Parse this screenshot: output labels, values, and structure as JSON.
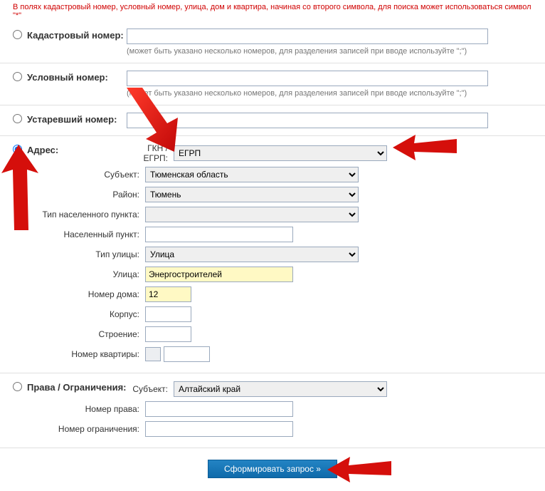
{
  "note": "В полях кадастровый номер, условный номер, улица, дом и квартира, начиная со второго символа, для поиска может использоваться символ \"*\"",
  "hint_multi": "(может быть указано несколько номеров, для разделения записей при вводе используйте \";\")",
  "sections": {
    "cad": {
      "label": "Кадастровый номер:"
    },
    "cond": {
      "label": "Условный номер:"
    },
    "old": {
      "label": "Устаревший номер:"
    },
    "addr": {
      "label": "Адрес:"
    },
    "rights": {
      "label": "Права / Ограничения:"
    }
  },
  "addr_fields": {
    "gkn": {
      "label": "ГКН / ЕГРП:",
      "value": "ЕГРП"
    },
    "subject": {
      "label": "Субъект:",
      "value": "Тюменская область"
    },
    "district": {
      "label": "Район:",
      "value": "Тюмень"
    },
    "settle_type": {
      "label": "Тип населенного пункта:",
      "value": ""
    },
    "settle": {
      "label": "Населенный пункт:",
      "value": ""
    },
    "street_type": {
      "label": "Тип улицы:",
      "value": "Улица"
    },
    "street": {
      "label": "Улица:",
      "value": "Энергостроителей"
    },
    "house": {
      "label": "Номер дома:",
      "value": "12"
    },
    "korpus": {
      "label": "Корпус:",
      "value": ""
    },
    "building": {
      "label": "Строение:",
      "value": ""
    },
    "apartment": {
      "label": "Номер квартиры:",
      "value": ""
    }
  },
  "rights_fields": {
    "subject": {
      "label": "Субъект:",
      "value": "Алтайский край"
    },
    "right_num": {
      "label": "Номер права:",
      "value": ""
    },
    "limit_num": {
      "label": "Номер ограничения:",
      "value": ""
    }
  },
  "button": "Сформировать запрос »"
}
